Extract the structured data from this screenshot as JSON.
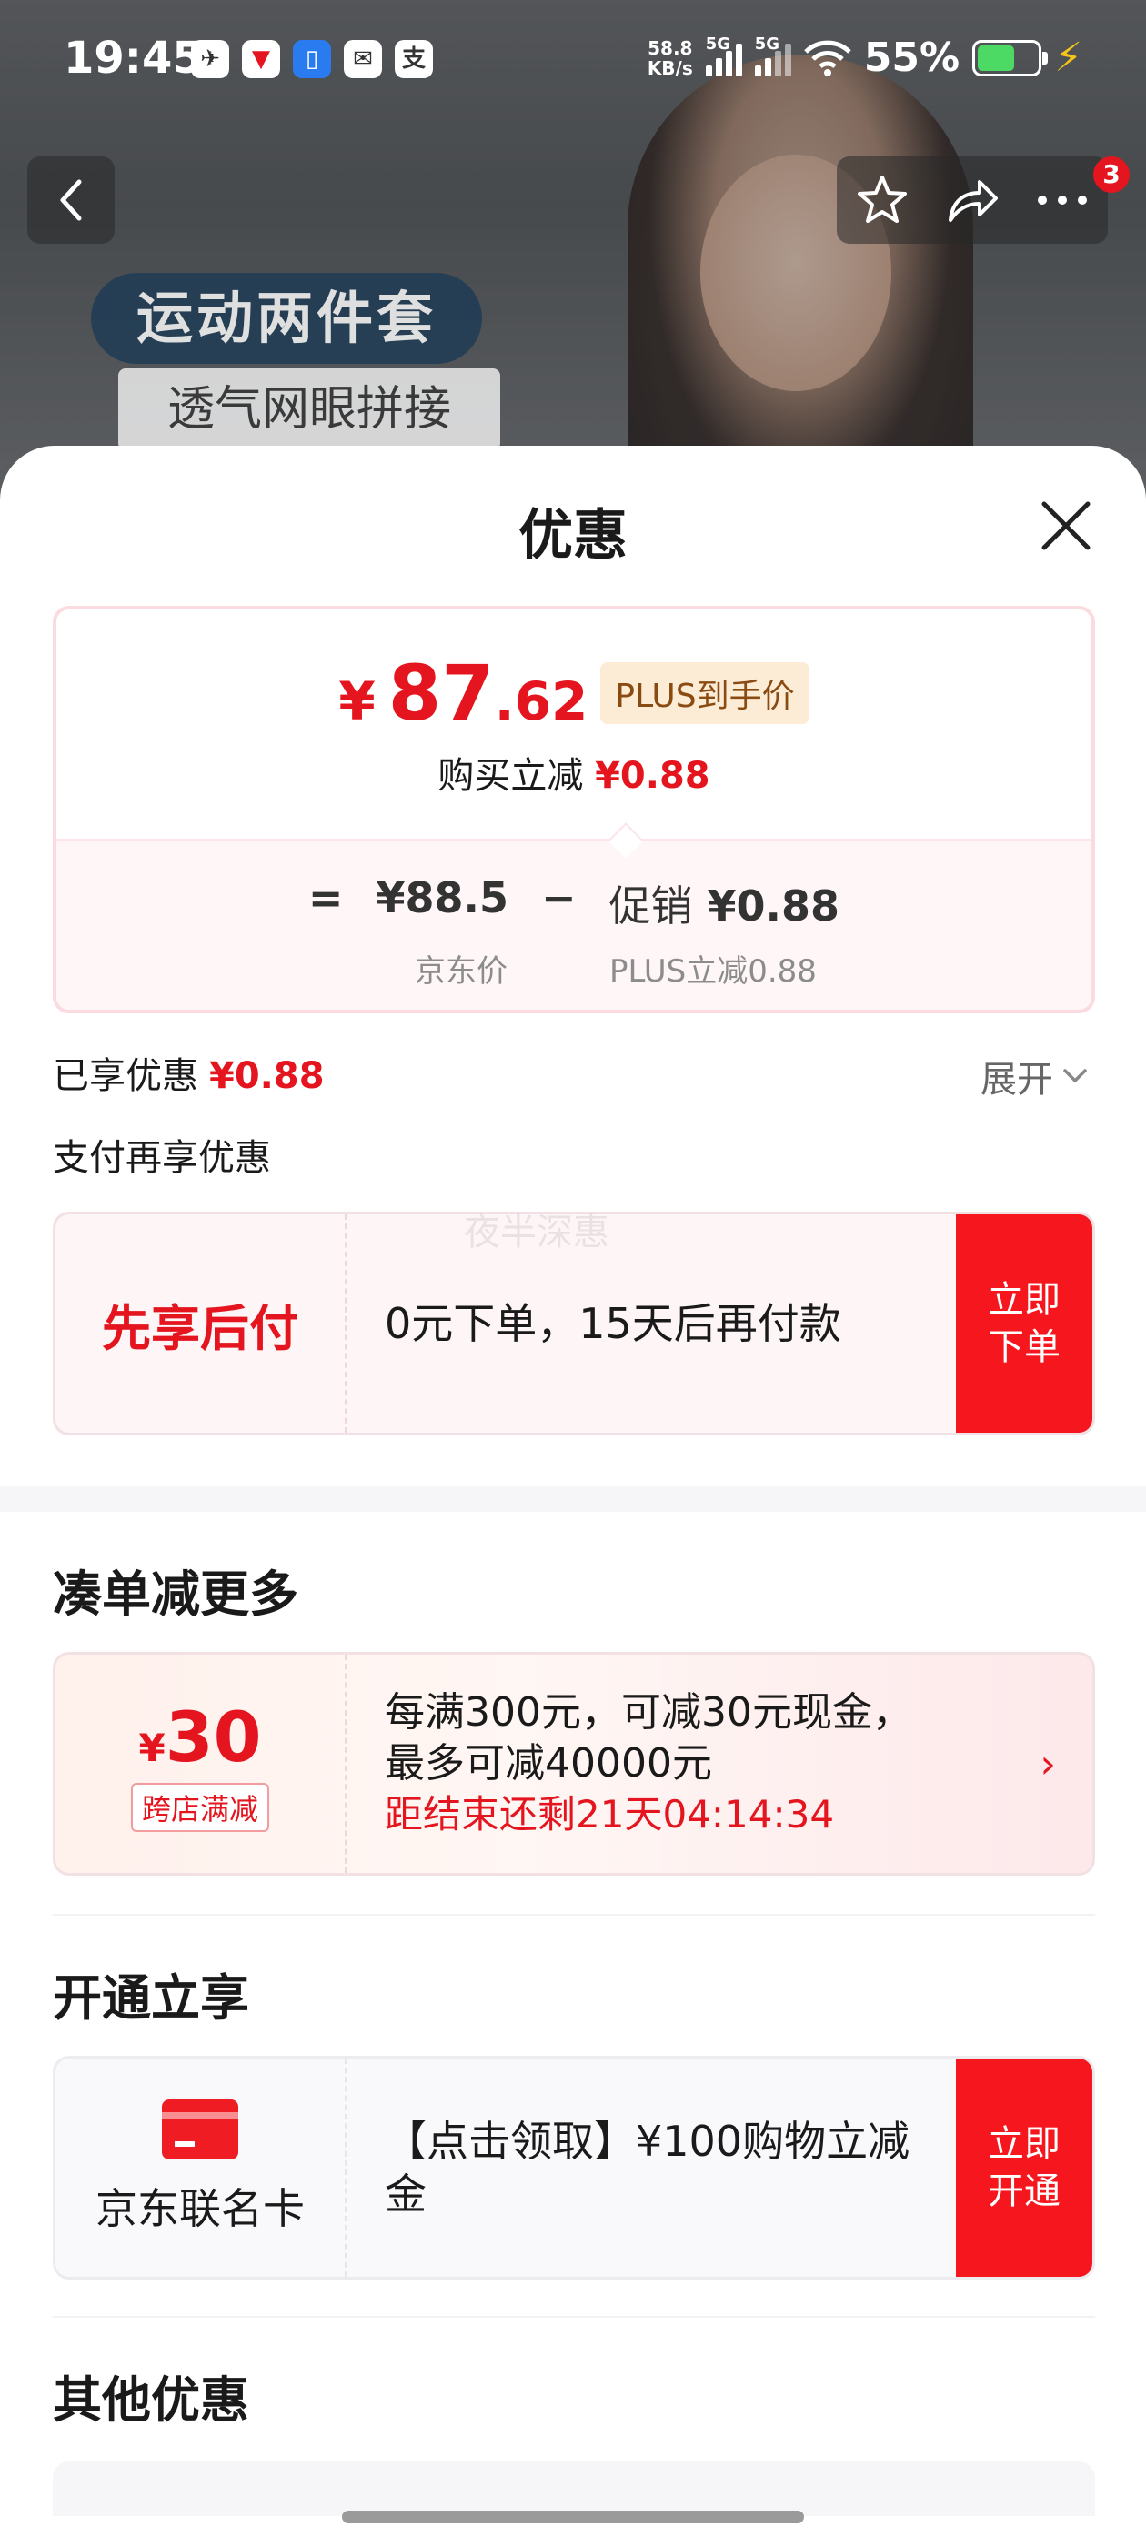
{
  "status_bar": {
    "time": "19:45",
    "net_speed_value": "58.8",
    "net_speed_unit": "KB/s",
    "signal1_label": "5G",
    "signal2_label": "5G",
    "battery_pct": "55%",
    "battery_level": 0.55
  },
  "background": {
    "promo_title": "运动两件套",
    "promo_subtitle": "透气网眼拼接"
  },
  "nav": {
    "badge_count": "3"
  },
  "sheet": {
    "title": "优惠"
  },
  "price": {
    "currency": "¥",
    "integer": "87",
    "decimal": ".62",
    "plus_tag": "PLUS到手价",
    "save_label": "购买立减",
    "save_value": "¥0.88",
    "equals": "=",
    "jd_price": "¥88.5",
    "minus": "−",
    "promo_label": "促销",
    "promo_value": "¥0.88",
    "jd_price_label": "京东价",
    "plus_discount_label": "PLUS立减0.88"
  },
  "enjoyed": {
    "label": "已享优惠",
    "value": "¥0.88",
    "expand_label": "展开"
  },
  "pay_section": {
    "title": "支付再享优惠",
    "watermark": "夜半深惠",
    "card_label": "先享后付",
    "card_text": "0元下单，15天后再付款",
    "cta_line1": "立即",
    "cta_line2": "下单"
  },
  "bundle_section": {
    "title": "凑单减更多",
    "coupon_currency": "¥",
    "coupon_amount": "30",
    "coupon_tag": "跨店满减",
    "line1": "每满300元，可减30元现金，",
    "line2": "最多可减40000元",
    "countdown": "距结束还剩21天04:14:34"
  },
  "open_section": {
    "title": "开通立享",
    "card_name": "京东联名卡",
    "text_line1": "【点击领取】¥100购物立减",
    "text_line2": "金",
    "cta_line1": "立即",
    "cta_line2": "开通"
  },
  "other_section": {
    "title": "其他优惠"
  },
  "colors": {
    "accent_red": "#e4151e",
    "cta_red": "#f5161e",
    "plus_tag_bg": "#fcecd6"
  }
}
